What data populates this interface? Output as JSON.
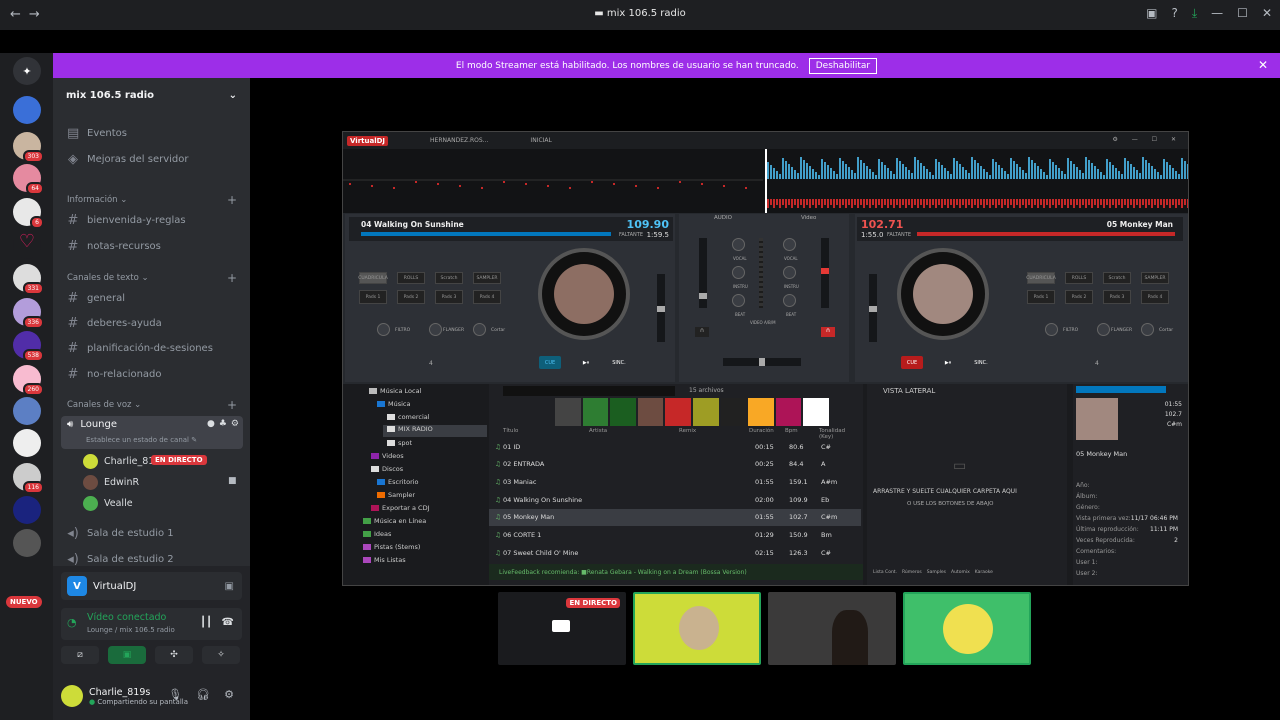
{
  "titlebar": {
    "title": "mix 106.5 radio",
    "back": "←",
    "forward": "→"
  },
  "banner": {
    "text": "El modo Streamer está habilitado. Los nombres de usuario se han truncado.",
    "button": "Deshabilitar"
  },
  "rail": {
    "badges": [
      "303",
      "64",
      "6",
      "331",
      "336",
      "538",
      "260",
      "116"
    ],
    "nuevo": "NUEVO"
  },
  "server": {
    "name": "mix 106.5 radio"
  },
  "sidebar": {
    "events": "Eventos",
    "boosts": "Mejoras del servidor",
    "cat_info": "Información",
    "ch_info": [
      "bienvenida-y-reglas",
      "notas-recursos"
    ],
    "cat_text": "Canales de texto",
    "ch_text": [
      "general",
      "deberes-ayuda",
      "planificación-de-sesiones",
      "no-relacionado"
    ],
    "cat_voice": "Canales de voz",
    "lounge": "Lounge",
    "lounge_status": "Establece un estado de canal",
    "voice_users": [
      "Charlie_819s",
      "EdwinR",
      "Vealle"
    ],
    "live": "EN DIRECTO",
    "voice_rooms": [
      "Sala de estudio 1",
      "Sala de estudio 2"
    ]
  },
  "panel": {
    "app": "VirtualDJ",
    "conn": "Vídeo conectado",
    "conn_sub": "Lounge / mix 106.5 radio",
    "user": "Charlie_819s",
    "user_status": "Compartiendo su pantalla"
  },
  "vdj": {
    "logo": "VirtualDJ",
    "user": "HERNANDEZ.ROS...",
    "design": "INICIAL",
    "left_title": "04 Walking On Sunshine",
    "left_bpm": "109.90",
    "left_time": "1:59.5",
    "left_faltante": "FALTANTE",
    "right_title": "05 Monkey Man",
    "right_bpm": "102.71",
    "right_time": "1:55.0",
    "right_faltante": "FALTANTE",
    "audio": "AUDIO",
    "video": "Video",
    "pad_top": [
      "CUADRICULA",
      "ROLLS",
      "Scratch",
      "SAMPLER"
    ],
    "pads": [
      "Pads 1",
      "Pads 2",
      "Pads 3",
      "Pads 4"
    ],
    "fx": [
      "FILTRO",
      "FLANGER",
      "Cortar"
    ],
    "cue": "CUE",
    "sync": "SINC.",
    "loop": "4",
    "mixer": [
      "VOCAL",
      "INSTRU",
      "BEAT",
      "VOCAL",
      "INSTRU",
      "BEAT"
    ],
    "crossfader": "VIDEO A/B/M",
    "tree": [
      "Música Local",
      "Música",
      "comercial",
      "MIX RADIO",
      "spot",
      "Videos",
      "Discos",
      "Escritorio",
      "Sampler",
      "Exportar a CDJ",
      "Música en Línea",
      "Ideas",
      "Pistas (Stems)",
      "Mis Listas"
    ],
    "files_count": "15 archivos",
    "cols": [
      "Título",
      "Artista",
      "Remix",
      "Duración",
      "Bpm",
      "Tonalidad (Key)"
    ],
    "tracks": [
      {
        "t": "01 ID",
        "d": "00:15",
        "b": "80.6",
        "k": "C#"
      },
      {
        "t": "02 ENTRADA",
        "d": "00:25",
        "b": "84.4",
        "k": "A"
      },
      {
        "t": "03 Maniac",
        "d": "01:55",
        "b": "159.1",
        "k": "A#m"
      },
      {
        "t": "04 Walking On Sunshine",
        "d": "02:00",
        "b": "109.9",
        "k": "Eb"
      },
      {
        "t": "05 Monkey Man",
        "d": "01:55",
        "b": "102.7",
        "k": "C#m"
      },
      {
        "t": "06 CORTE 1",
        "d": "01:29",
        "b": "150.9",
        "k": "Bm"
      },
      {
        "t": "07 Sweet Child O' Mine",
        "d": "02:15",
        "b": "126.3",
        "k": "C#"
      }
    ],
    "livefeedback": "LiveFeedback recomienda: ■Renata Gebara - Walking on a Dream (Bossa Version)",
    "side_title": "VISTA LATERAL",
    "side_drop": "ARRASTRE Y SUELTE CUALQUIER CARPETA AQUI",
    "side_drop2": "O USE LOS BOTONES DE ABAJO",
    "side_tabs": [
      "Lista Cont.",
      "Rúmeros",
      "Samples",
      "Automix",
      "Karaoke"
    ],
    "info_time": "01:55",
    "info_bpm": "102.7",
    "info_key": "C#m",
    "info_title": "05 Monkey Man",
    "info_fields": [
      "Año:",
      "Álbum:",
      "Género:",
      "Vista primera vez:",
      "Última reproducción:",
      "Veces Reproducida:",
      "Comentarios:",
      "User 1:",
      "User 2:"
    ],
    "info_values": [
      "",
      "",
      "",
      "11/17 06:46 PM",
      "11:11 PM",
      "2",
      "",
      "",
      ""
    ]
  },
  "streams": {
    "live": "EN DIRECTO"
  },
  "colors": {
    "accent": "#9d2ee8",
    "live": "#da373c",
    "left": "#4fc3f7",
    "right": "#ef5350",
    "green": "#23a55a"
  }
}
